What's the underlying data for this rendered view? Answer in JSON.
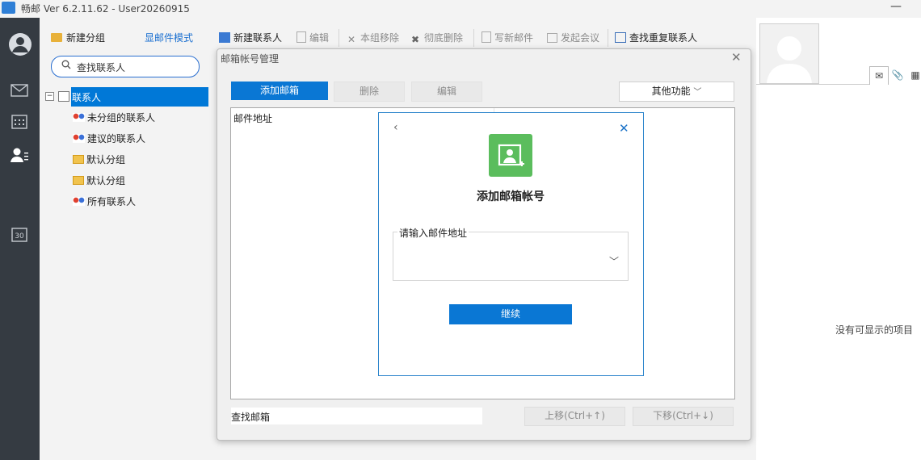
{
  "window": {
    "title": "畅邮 Ver 6.2.11.62  -  User20260915",
    "minimize_glyph": "—"
  },
  "contacts": {
    "new_group": "新建分组",
    "mail_mode": "显邮件模式",
    "search_placeholder": "查找联系人",
    "tree": {
      "root": "联系人",
      "items": [
        {
          "label": "未分组的联系人",
          "icon": "people-icon"
        },
        {
          "label": "建议的联系人",
          "icon": "people-icon"
        },
        {
          "label": "默认分组",
          "icon": "folder-icon"
        },
        {
          "label": "默认分组",
          "icon": "folder-icon"
        },
        {
          "label": "所有联系人",
          "icon": "people-icon"
        }
      ]
    }
  },
  "toolbar": {
    "new_contact": "新建联系人",
    "edit": "编辑",
    "remove_from_group": "本组移除",
    "delete_permanently": "彻底删除",
    "write_mail": "写新邮件",
    "start_meeting": "发起会议",
    "find_duplicates": "查找重复联系人"
  },
  "right_panel": {
    "empty_message": "没有可显示的项目"
  },
  "dialog": {
    "title": "邮箱帐号管理",
    "add_mailbox": "添加邮箱",
    "delete": "删除",
    "edit": "编辑",
    "other": "其他功能",
    "column_mail_address": "邮件地址",
    "find_mailbox": "查找邮箱",
    "move_up": "上移(Ctrl+↑)",
    "move_down": "下移(Ctrl+↓)"
  },
  "add_modal": {
    "back_glyph": "‹",
    "close_glyph": "✕",
    "title": "添加邮箱帐号",
    "address_label": "请输入邮件地址",
    "address_value": "",
    "continue": "继续"
  },
  "colors": {
    "accent": "#0a77d4",
    "rail": "#353b42",
    "card_icon": "#5bbd5d"
  }
}
